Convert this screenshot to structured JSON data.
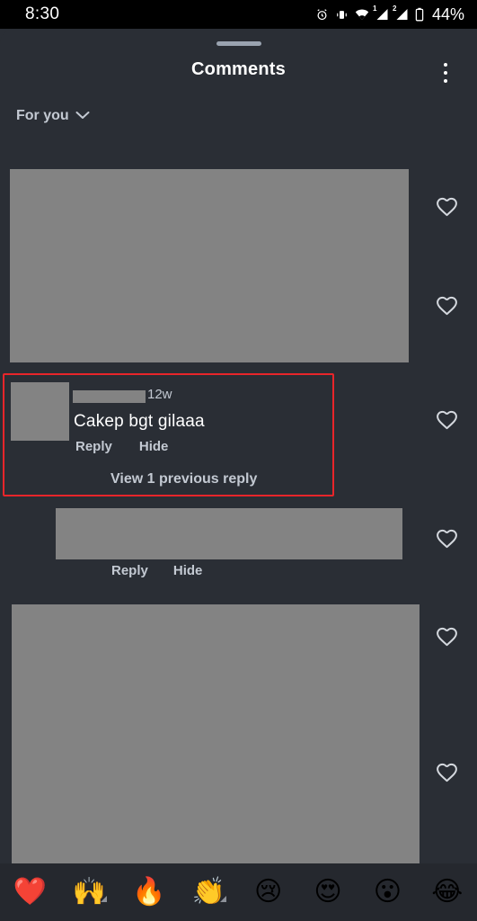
{
  "status_bar": {
    "time": "8:30",
    "battery_percent": "44%",
    "icons": [
      "alarm-icon",
      "vibrate-icon",
      "wifi-icon",
      "signal-sim1-icon",
      "signal-sim2-icon",
      "battery-icon"
    ],
    "sim1_label": "1",
    "sim2_label": "2"
  },
  "sheet": {
    "title": "Comments",
    "menu_icon": "kebab-menu-icon",
    "drag_handle": "drag-handle"
  },
  "filter": {
    "label": "For you",
    "chevron_icon": "chevron-down-icon"
  },
  "comments": [
    {
      "type": "redacted-block",
      "like_icon": "heart-outline-icon"
    },
    {
      "type": "comment",
      "highlighted": true,
      "highlight_color": "#e8252a",
      "avatar": "user-avatar",
      "username_redacted": true,
      "timestamp": "12w",
      "text": "Cakep bgt gilaaa",
      "actions": [
        "Reply",
        "Hide"
      ],
      "view_previous": "View 1 previous reply",
      "like_icon": "heart-outline-icon"
    },
    {
      "type": "reply",
      "text_redacted": true,
      "actions": [
        "Reply",
        "Hide"
      ],
      "like_icon": "heart-outline-icon"
    },
    {
      "type": "redacted-block",
      "like_icon": "heart-outline-icon"
    }
  ],
  "emoji_bar": {
    "items": [
      {
        "emoji": "❤️",
        "name": "heart-emoji",
        "has_corner": false
      },
      {
        "emoji": "🙌",
        "name": "raising-hands-emoji",
        "has_corner": true
      },
      {
        "emoji": "🔥",
        "name": "fire-emoji",
        "has_corner": false
      },
      {
        "emoji": "👏",
        "name": "clapping-hands-emoji",
        "has_corner": true
      },
      {
        "emoji": "😢",
        "name": "crying-face-emoji",
        "has_corner": false
      },
      {
        "emoji": "😍",
        "name": "heart-eyes-emoji",
        "has_corner": false
      },
      {
        "emoji": "😮",
        "name": "open-mouth-emoji",
        "has_corner": false
      },
      {
        "emoji": "😂",
        "name": "tears-of-joy-emoji",
        "has_corner": false
      }
    ]
  },
  "colors": {
    "sheet_background": "#2a2e35",
    "status_background": "#000000",
    "redaction": "#838383",
    "secondary_text": "#c3c9d2",
    "highlight": "#e8252a",
    "emoji_bar_background": "#25282e"
  }
}
